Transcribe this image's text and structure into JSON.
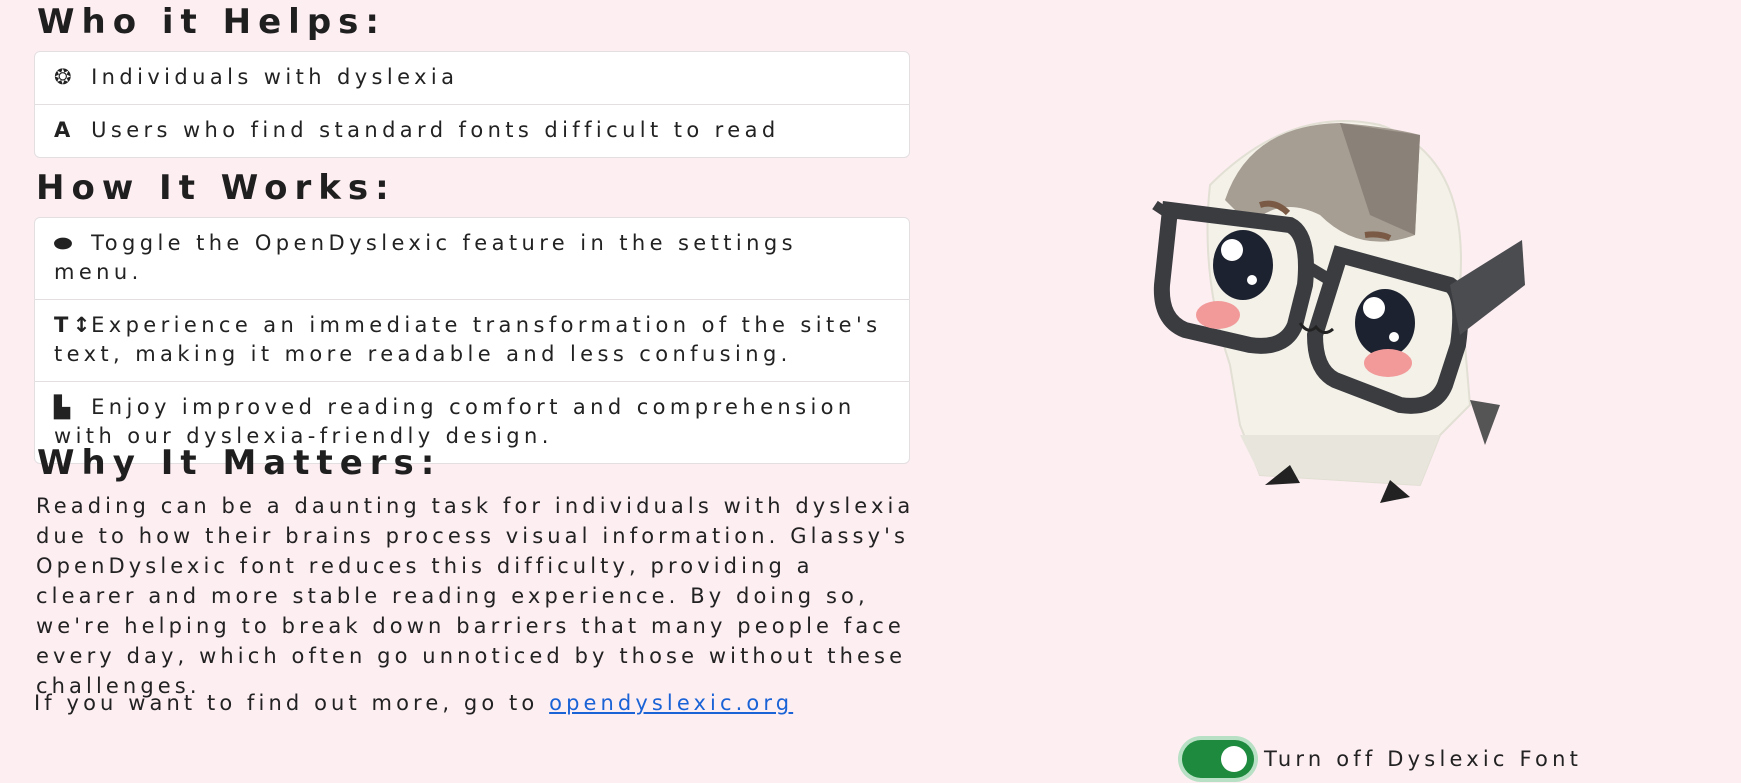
{
  "who": {
    "heading": "Who it Helps:",
    "items": [
      {
        "icon": "brain-icon",
        "glyph": "❂",
        "text": "Individuals with dyslexia"
      },
      {
        "icon": "font-icon",
        "glyph": "A",
        "text": "Users who find standard fonts difficult to read"
      }
    ]
  },
  "how": {
    "heading": "How It Works:",
    "items": [
      {
        "icon": "toggle-icon",
        "glyph": "⬬",
        "text": "Toggle the OpenDyslexic feature in the settings menu."
      },
      {
        "icon": "text-height-icon",
        "glyph": "T↕",
        "text": "Experience an immediate transformation of the site's text, making it more readable and less confusing."
      },
      {
        "icon": "book-reader-icon",
        "glyph": "▙",
        "text": "Enjoy improved reading comfort and comprehension with our dyslexia-friendly design."
      }
    ]
  },
  "why": {
    "heading": "Why It Matters:",
    "text": "Reading can be a daunting task for individuals with dyslexia due to how their brains process visual information. Glassy's OpenDyslexic font reduces this difficulty, providing a clearer and more stable reading experience. By doing so, we're helping to break down barriers that many people face every day, which often go unnoticed by those without these challenges."
  },
  "more": {
    "prefix": "If you want to find out more, go to",
    "link_text": "opendyslexic.org"
  },
  "toggle": {
    "label": "Turn off Dyslexic Font",
    "state": "on",
    "color": "#1e8a3e"
  },
  "colors": {
    "background": "#fdeef2",
    "link": "#1a63d6"
  }
}
